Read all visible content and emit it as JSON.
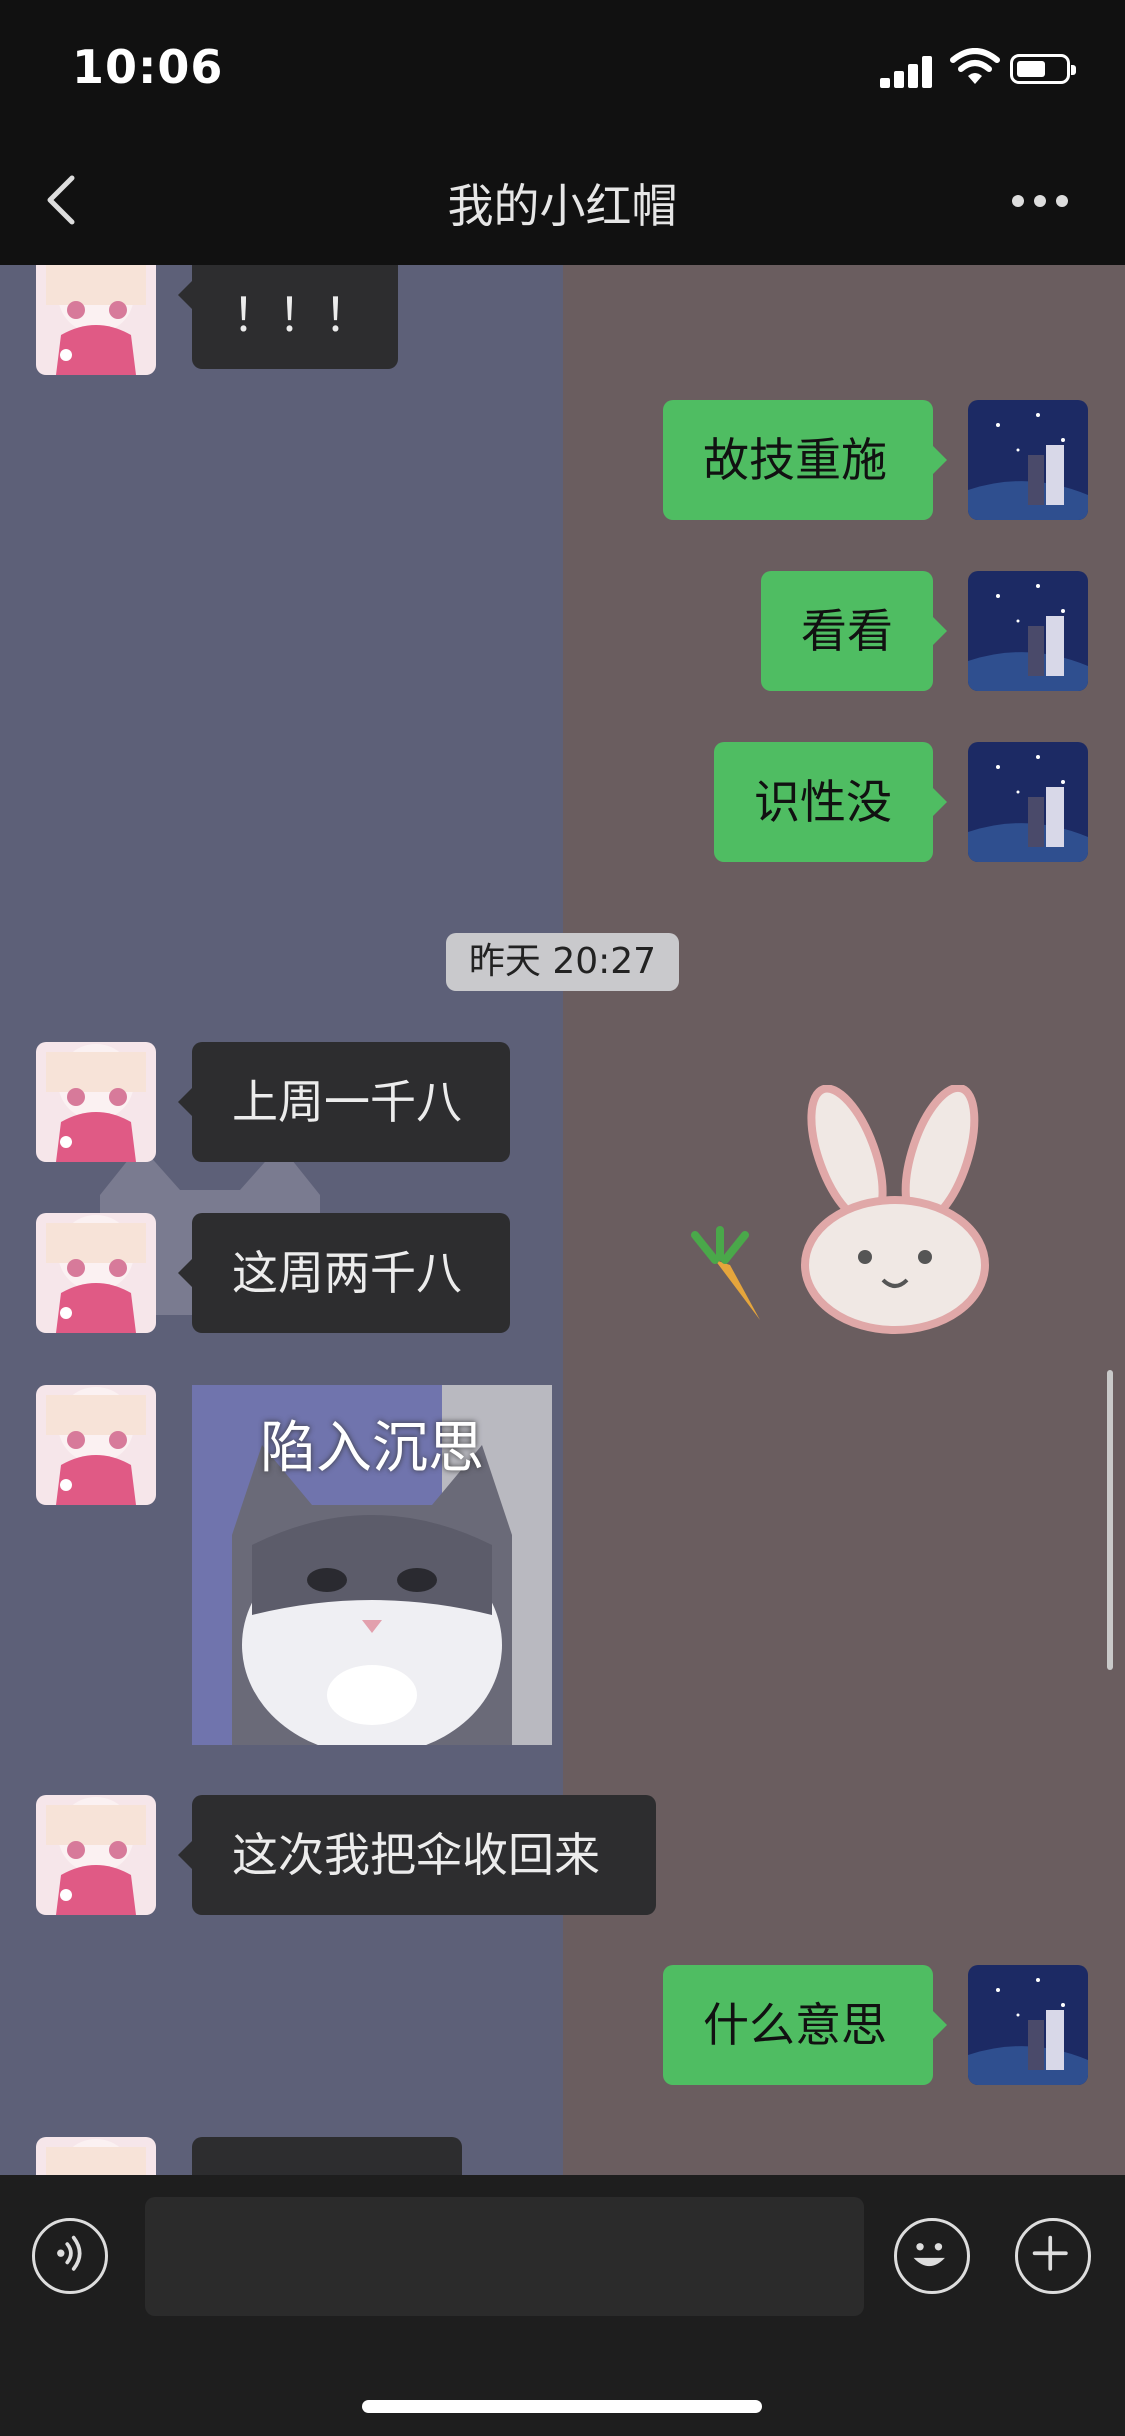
{
  "status_bar": {
    "time": "10:06"
  },
  "header": {
    "title": "我的小红帽"
  },
  "messages": [
    {
      "side": "in",
      "text": "！！！"
    },
    {
      "side": "out",
      "text": "故技重施"
    },
    {
      "side": "out",
      "text": "看看"
    },
    {
      "side": "out",
      "text": "识性没"
    },
    {
      "side": "in",
      "text": "上周一千八"
    },
    {
      "side": "in",
      "text": "这周两千八"
    },
    {
      "side": "in",
      "sticker_caption": "陷入沉思"
    },
    {
      "side": "in",
      "text": "这次我把伞收回来"
    },
    {
      "side": "out",
      "text": "什么意思"
    }
  ],
  "timestamp": "昨天 20:27",
  "colors": {
    "outgoing_bubble": "#4fbd62",
    "incoming_bubble": "#2d2d2f"
  }
}
